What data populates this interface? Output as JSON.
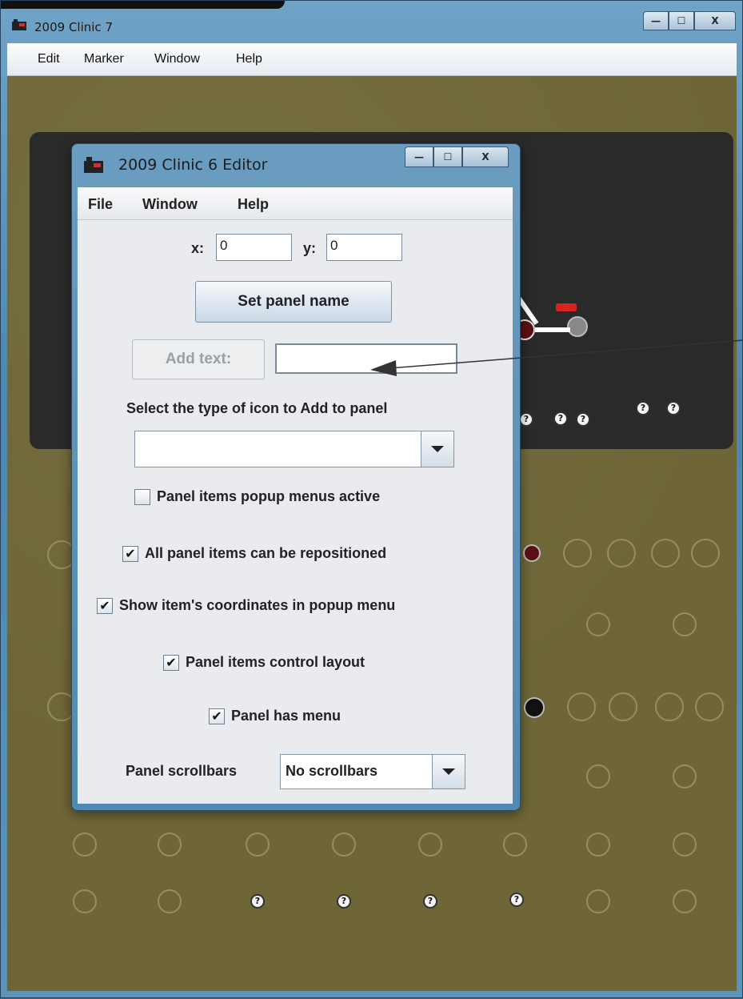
{
  "main_window": {
    "title": "2009 Clinic 7",
    "minimize_glyph": "—",
    "maximize_glyph": "☐",
    "close_glyph": "X",
    "menu": [
      "Edit",
      "Marker",
      "Window",
      "Help"
    ]
  },
  "panel": {
    "question_icon_glyph": "?"
  },
  "editor": {
    "title": "2009 Clinic 6 Editor",
    "minimize_glyph": "—",
    "maximize_glyph": "☐",
    "close_glyph": "X",
    "menu": [
      "File",
      "Window",
      "Help"
    ],
    "x_label": "x:",
    "x_value": "0",
    "y_label": "y:",
    "y_value": "0",
    "set_panel_name_label": "Set panel name",
    "add_text_label": "Add text:",
    "add_text_value": "",
    "icon_type_label": "Select the type of icon to Add to panel",
    "icon_type_selected": "",
    "checkboxes": [
      {
        "label": "Panel items popup menus active",
        "checked": false
      },
      {
        "label": "All panel items can be repositioned",
        "checked": true
      },
      {
        "label": "Show item's coordinates in popup menu",
        "checked": true
      },
      {
        "label": "Panel items control layout",
        "checked": true
      },
      {
        "label": "Panel has menu",
        "checked": true
      }
    ],
    "check_glyph": "✔",
    "scrollbars_label": "Panel scrollbars",
    "scrollbars_selected": "No scrollbars"
  },
  "colors": {
    "panel_background": "#6e6637",
    "dark_panel": "#2a2a2a",
    "window_frame": "#5d93b8"
  }
}
